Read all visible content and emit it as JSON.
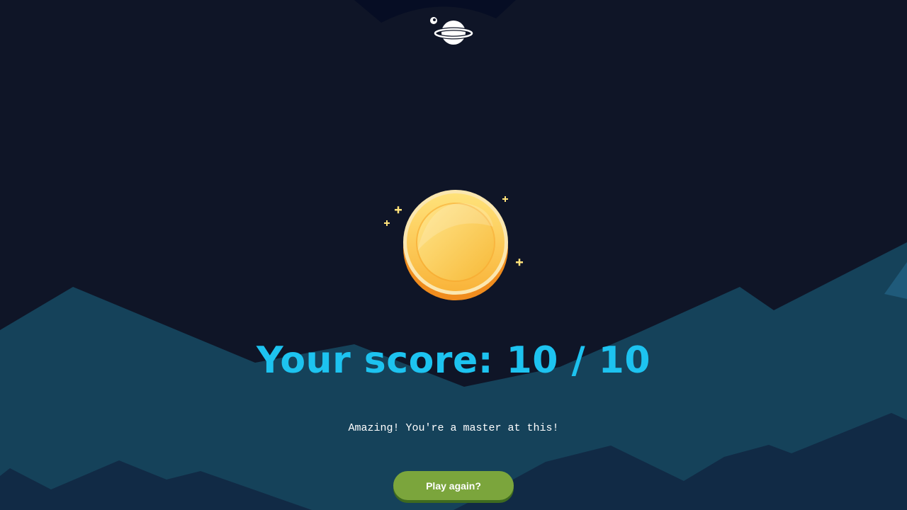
{
  "result": {
    "score_text": "Your score: 10 / 10",
    "message": "Amazing! You're a master at this!"
  },
  "actions": {
    "play_again_label": "Play again?"
  },
  "icons": {
    "logo": "planet-with-moon-icon",
    "reward": "gold-coin-icon",
    "sparkles": "sparkle-icon"
  },
  "colors": {
    "background": "#0f1527",
    "score_text": "#1dc3f0",
    "button": "#7ba53c",
    "mountains_back": "#15425a",
    "mountains_front": "#112a45",
    "coin_gold": "#f7b733"
  }
}
